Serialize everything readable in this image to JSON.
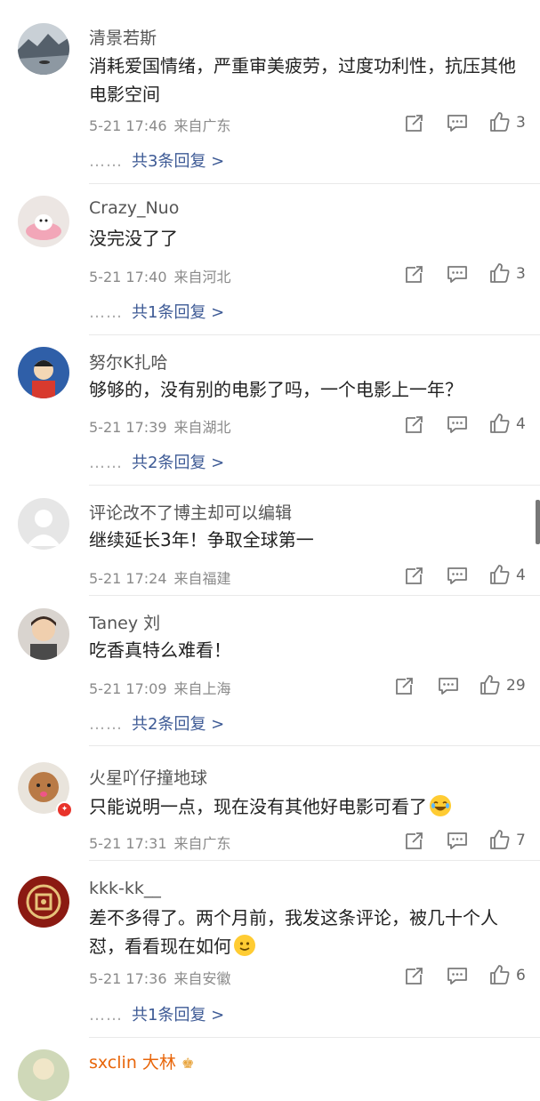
{
  "comments": [
    {
      "name": "清景若斯",
      "text": "消耗爱国情绪，严重审美疲劳，过度功利性，抗压其他电影空间",
      "time": "5-21 17:46",
      "location": "来自广东",
      "likes": "3",
      "replies": "共3条回复 >"
    },
    {
      "name": "Crazy_Nuo",
      "text": "没完没了了",
      "time": "5-21 17:40",
      "location": "来自河北",
      "likes": "3",
      "replies": "共1条回复 >"
    },
    {
      "name": "努尔K扎哈",
      "text": "够够的，没有别的电影了吗，一个电影上一年？",
      "time": "5-21 17:39",
      "location": "来自湖北",
      "likes": "4",
      "replies": "共2条回复 >"
    },
    {
      "name": "评论改不了博主却可以编辑",
      "text": "继续延长3年！争取全球第一",
      "time": "5-21 17:24",
      "location": "来自福建",
      "likes": "4",
      "replies": ""
    },
    {
      "name": "Taney 刘",
      "text": "吃香真特么难看！",
      "time": "5-21 17:09",
      "location": "来自上海",
      "likes": "29",
      "replies": "共2条回复 >"
    },
    {
      "name": "火星吖仔撞地球",
      "text": "只能说明一点，现在没有其他好电影可看了",
      "time": "5-21 17:31",
      "location": "来自广东",
      "likes": "7",
      "replies": ""
    },
    {
      "name": "kkk-kk__",
      "text": "差不多得了。两个月前，我发这条评论，被几十个人怼，看看现在如何",
      "time": "5-21 17:36",
      "location": "来自安徽",
      "likes": "6",
      "replies": "共1条回复 >"
    },
    {
      "name": "sxclin 大林",
      "text": "",
      "time": "",
      "location": "",
      "likes": "",
      "replies": ""
    }
  ],
  "reply_dots": "……",
  "colors": {
    "link": "#3d5a95",
    "name_vip": "#e8660a",
    "badge": "#e8332a"
  }
}
